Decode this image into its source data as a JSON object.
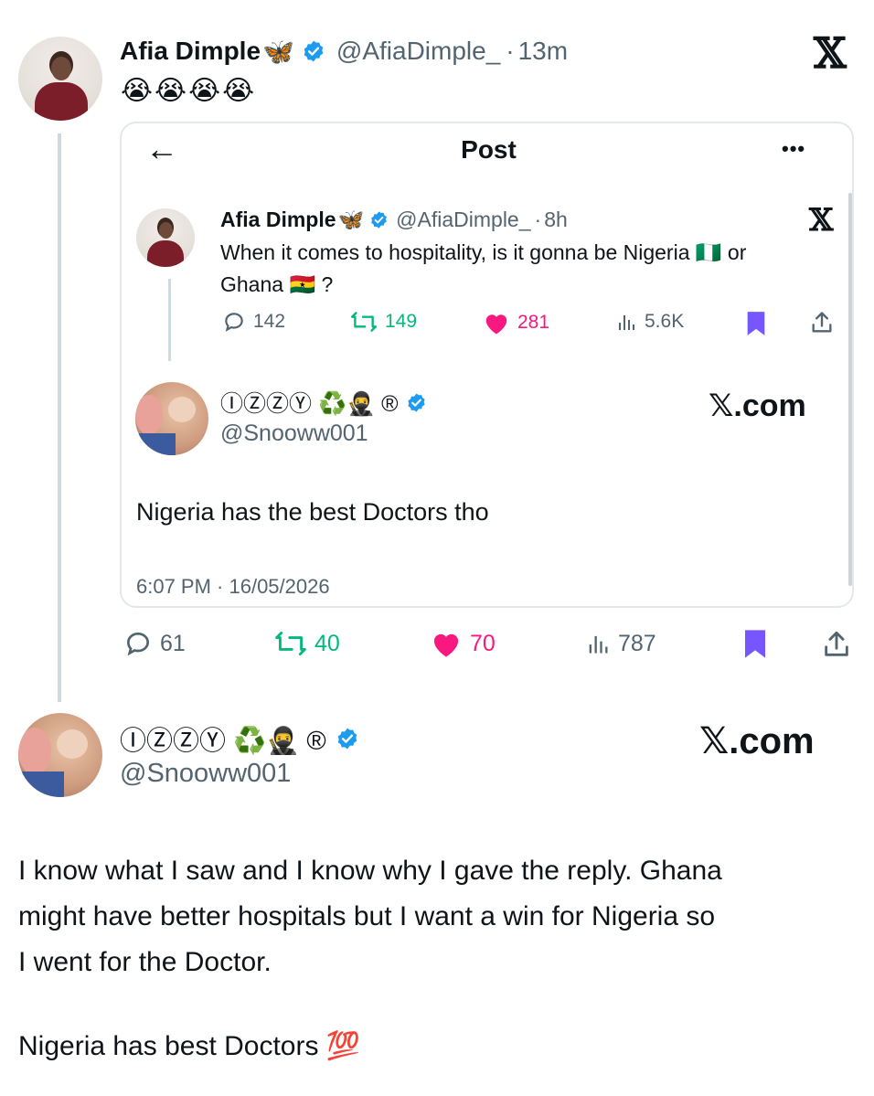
{
  "outer": {
    "author_name": "Afia Dimple",
    "author_emoji": "🦋",
    "handle": "@AfiaDimple_",
    "time_sep": "·",
    "time": "13m",
    "text": "😭😭😭😭",
    "x_logo": "𝕏"
  },
  "card": {
    "back_icon": "←",
    "title": "Post",
    "more_icon": "•••",
    "inner": {
      "author_name": "Afia Dimple",
      "author_emoji": "🦋",
      "handle": "@AfiaDimple_",
      "time_sep": "·",
      "time": "8h",
      "x_logo": "𝕏",
      "text_line1": "When it comes to hospitality, is it gonna be Nigeria 🇳🇬 or",
      "text_line2": "Ghana 🇬🇭 ?",
      "stats": {
        "replies": "142",
        "retweets": "149",
        "likes": "281",
        "views": "5.6K"
      }
    },
    "reply": {
      "display_name": "ⒾⓏⓏⓎ ♻️🥷 ®",
      "handle": "@Snooww001",
      "xcom": "𝕏.com",
      "text": "Nigeria has the best Doctors tho",
      "timestamp": "6:07 PM · 16/05/2026"
    }
  },
  "outer_stats": {
    "replies": "61",
    "retweets": "40",
    "likes": "70",
    "views": "787"
  },
  "bottom": {
    "display_name": "ⒾⓏⓏⓎ ♻️🥷 ®",
    "handle": "@Snooww001",
    "xcom": "𝕏.com",
    "text_line1": "I know what I saw and I know why I gave the reply. Ghana",
    "text_line2": "might have better hospitals but I want a win for Nigeria so",
    "text_line3": "I went for the Doctor.",
    "text_line4": "Nigeria has best Doctors 💯"
  },
  "colors": {
    "verified": "#1d9bf0",
    "retweet": "#00ba7c",
    "like": "#f91880",
    "bookmark": "#7856ff",
    "muted": "#536471"
  }
}
